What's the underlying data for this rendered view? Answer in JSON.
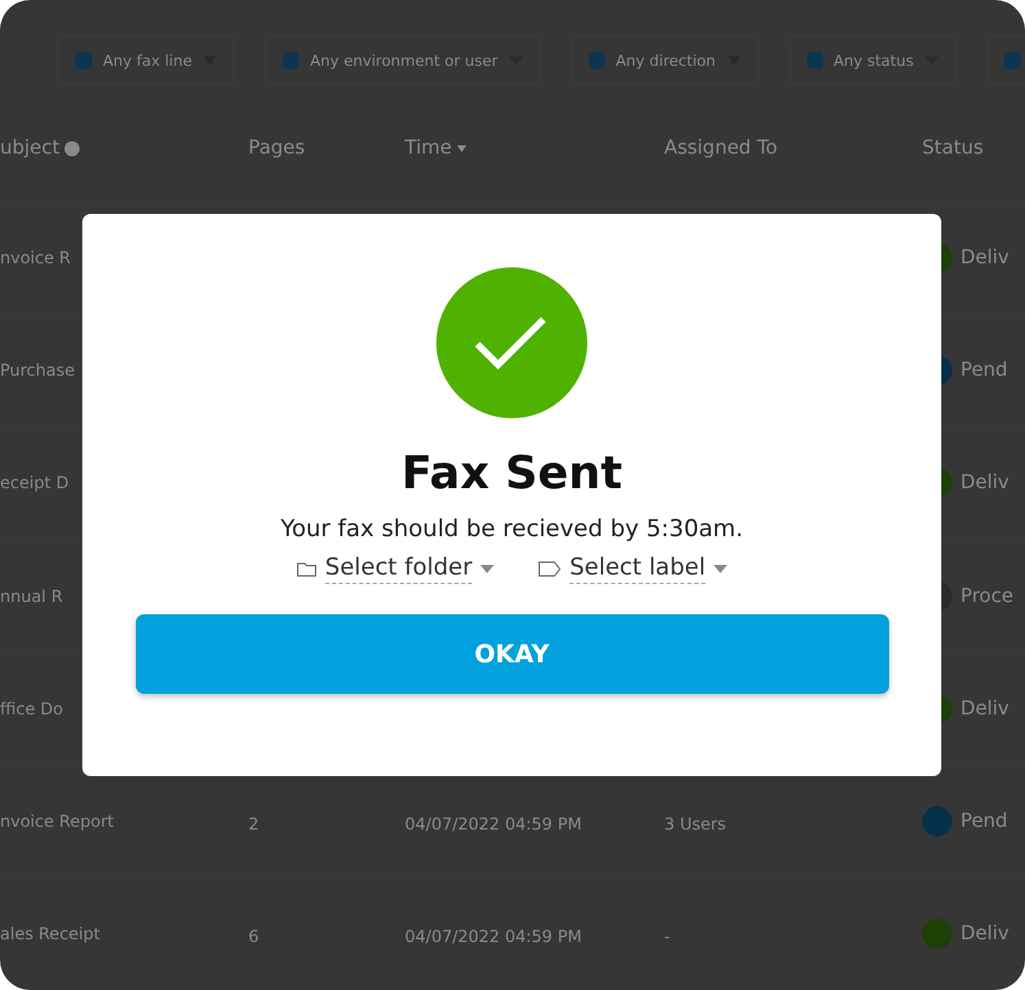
{
  "filters": [
    {
      "label": "Any fax line"
    },
    {
      "label": "Any environment or user"
    },
    {
      "label": "Any direction"
    },
    {
      "label": "Any status"
    }
  ],
  "columns": [
    {
      "label": "ubject",
      "info": true,
      "sorted": false
    },
    {
      "label": "Pages",
      "info": false,
      "sorted": false
    },
    {
      "label": "Time",
      "info": false,
      "sorted": true
    },
    {
      "label": "Assigned To",
      "info": false,
      "sorted": false
    },
    {
      "label": "Status",
      "info": false,
      "sorted": false
    }
  ],
  "rows": [
    {
      "subject": "nvoice R",
      "status": "Deliv",
      "color": "#1e3f05"
    },
    {
      "subject": "Purchase",
      "status": "Pend",
      "color": "#06314a"
    },
    {
      "subject": "eceipt D",
      "status": "Deliv",
      "color": "#1e3f05"
    },
    {
      "subject": "nnual R",
      "status": "Proce",
      "color": "#2a2a2a"
    },
    {
      "subject": "ffice Do",
      "status": "Deliv",
      "color": "#1e3f05"
    },
    {
      "subject": "nvoice Report",
      "pages": "2",
      "time": "04/07/2022 04:59 PM",
      "assigned": "3 Users",
      "status": "Pend",
      "color": "#06314a"
    },
    {
      "subject": "ales Receipt",
      "pages": "6",
      "time": "04/07/2022 04:59 PM",
      "assigned": "-",
      "status": "Deliv",
      "color": "#1e3f05"
    }
  ],
  "dialog": {
    "title": "Fax Sent",
    "message": "Your fax should be recieved by 5:30am.",
    "folder_select": {
      "placeholder": "Select folder"
    },
    "label_select": {
      "placeholder": "Select label"
    },
    "button": "OKAY"
  }
}
